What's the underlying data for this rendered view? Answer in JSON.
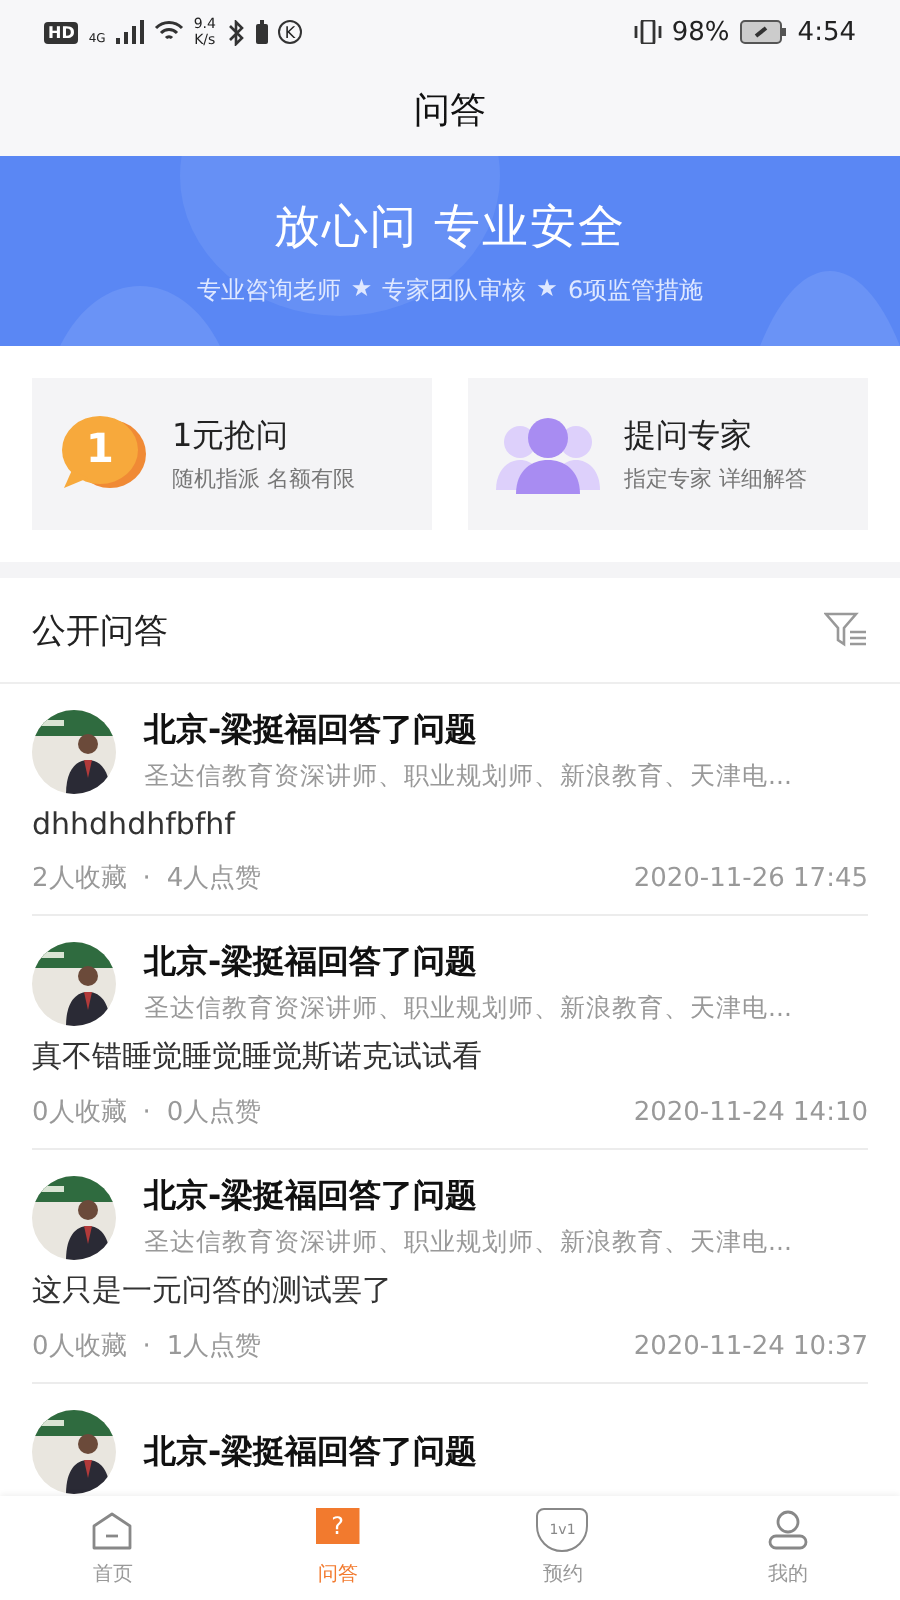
{
  "status_bar": {
    "hd": "HD",
    "network": "4G",
    "speed_value": "9.4",
    "speed_unit": "K/s",
    "k_mark": "K",
    "battery": "98%",
    "time": "4:54"
  },
  "header": {
    "title": "问答"
  },
  "banner": {
    "headline": "放心问 专业安全",
    "separator": "★",
    "features": [
      "专业咨询老师",
      "专家团队审核",
      "6项监管措施"
    ]
  },
  "actions": [
    {
      "kind": "coin",
      "badge": "1",
      "title": "1元抢问",
      "subtitle": "随机指派 名额有限"
    },
    {
      "kind": "people",
      "title": "提问专家",
      "subtitle": "指定专家 详细解答"
    }
  ],
  "section": {
    "title": "公开问答"
  },
  "answers": [
    {
      "title": "北京-梁挺福回答了问题",
      "subtitle": "圣达信教育资深讲师、职业规划师、新浪教育、天津电...",
      "body": "dhhdhdhfbfhf",
      "favorites": "2人收藏",
      "separator": "·",
      "likes": "4人点赞",
      "date": "2020-11-26 17:45"
    },
    {
      "title": "北京-梁挺福回答了问题",
      "subtitle": "圣达信教育资深讲师、职业规划师、新浪教育、天津电...",
      "body": "真不错睡觉睡觉睡觉斯诺克试试看",
      "favorites": "0人收藏",
      "separator": "·",
      "likes": "0人点赞",
      "date": "2020-11-24 14:10"
    },
    {
      "title": "北京-梁挺福回答了问题",
      "subtitle": "圣达信教育资深讲师、职业规划师、新浪教育、天津电...",
      "body": "这只是一元问答的测试罢了",
      "favorites": "0人收藏",
      "separator": "·",
      "likes": "1人点赞",
      "date": "2020-11-24 10:37"
    },
    {
      "title": "北京-梁挺福回答了问题"
    }
  ],
  "tabs": [
    {
      "kind": "home",
      "label": "首页",
      "selected": false
    },
    {
      "kind": "qa",
      "label": "问答",
      "icon_text": "?",
      "selected": true
    },
    {
      "kind": "booking",
      "label": "预约",
      "icon_text": "1v1",
      "selected": false
    },
    {
      "kind": "profile",
      "label": "我的",
      "selected": false
    }
  ]
}
